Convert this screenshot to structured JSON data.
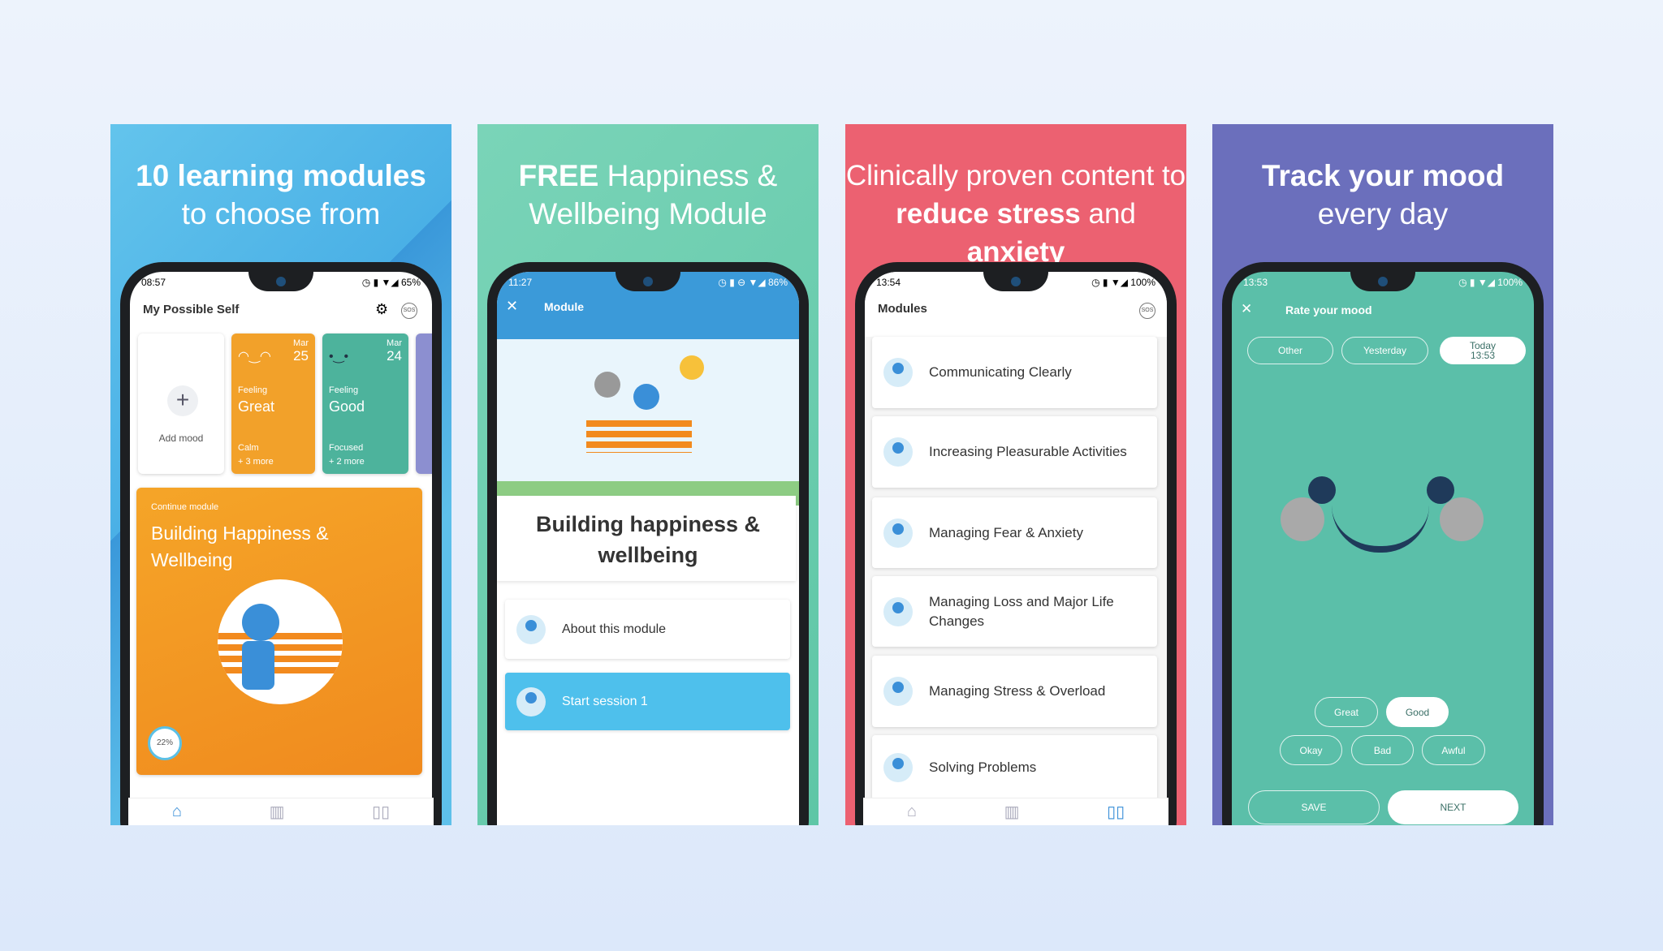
{
  "panels": [
    {
      "title_bold": "10 learning modules",
      "title_rest": "to choose from",
      "bg": "#4fb3e6",
      "status": {
        "time": "08:57",
        "battery": "65%"
      },
      "app_title": "My Possible Self",
      "add_mood": "Add mood",
      "moods": [
        {
          "month": "Mar",
          "day": "25",
          "feeling_label": "Feeling",
          "feeling": "Great",
          "tag": "Calm",
          "more": "+ 3 more",
          "color": "#f2a12a"
        },
        {
          "month": "Mar",
          "day": "24",
          "feeling_label": "Feeling",
          "feeling": "Good",
          "tag": "Focused",
          "more": "+ 2 more",
          "color": "#4db39c"
        }
      ],
      "continue_label": "Continue module",
      "module_title": "Building Happiness & Wellbeing",
      "progress": "22%"
    },
    {
      "title_bold": "FREE",
      "title_rest_1": "Happiness &",
      "title_rest_2": "Wellbeing Module",
      "bg": "#6ccdb0",
      "status": {
        "time": "11:27",
        "battery": "86%"
      },
      "header": "Module",
      "module_title": "Building happiness & wellbeing",
      "about": "About this module",
      "start": "Start session 1"
    },
    {
      "title_line1": "Clinically proven content to",
      "title_bold_1": "reduce stress",
      "title_mid": "and",
      "title_bold_2": "anxiety",
      "bg": "#ec6171",
      "status": {
        "time": "13:54",
        "battery": "100%"
      },
      "header": "Modules",
      "modules": [
        "Communicating Clearly",
        "Increasing Pleasurable Activities",
        "Managing Fear & Anxiety",
        "Managing Loss and Major Life Changes",
        "Managing Stress & Overload",
        "Solving Problems"
      ]
    },
    {
      "title_bold": "Track your mood",
      "title_rest": "every day",
      "bg": "#6b6fbc",
      "status": {
        "time": "13:53",
        "battery": "100%"
      },
      "header": "Rate your mood",
      "tabs": [
        "Other",
        "Yesterday",
        "Today 13:53"
      ],
      "moods": [
        "Great",
        "Good",
        "Okay",
        "Bad",
        "Awful"
      ],
      "selected_mood": "Good",
      "save": "SAVE",
      "next": "NEXT",
      "screen_color": "#5bbfa9"
    }
  ],
  "sos": "SOS"
}
